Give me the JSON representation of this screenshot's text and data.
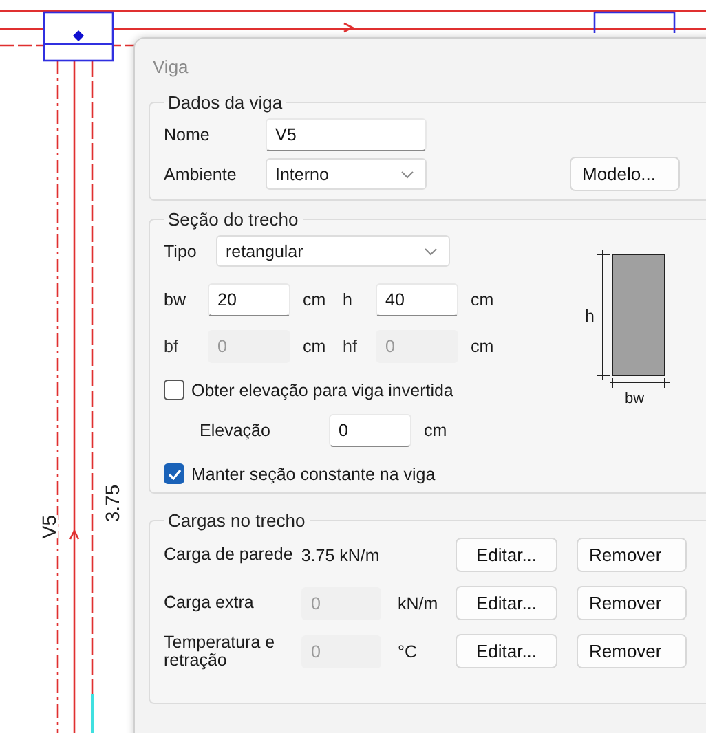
{
  "drawing": {
    "beam_label": "V5",
    "span_label": "3.75"
  },
  "dialog": {
    "title": "Viga"
  },
  "beam_data": {
    "title": "Dados da viga",
    "name_label": "Nome",
    "name_value": "V5",
    "environment_label": "Ambiente",
    "environment_value": "Interno",
    "model_button": "Modelo..."
  },
  "section": {
    "title": "Seção do trecho",
    "type_label": "Tipo",
    "type_value": "retangular",
    "fields": [
      {
        "label": "bw",
        "value": "20",
        "unit": "cm",
        "disabled": false
      },
      {
        "label": "h",
        "value": "40",
        "unit": "cm",
        "disabled": false
      },
      {
        "label": "bf",
        "value": "0",
        "unit": "cm",
        "disabled": true
      },
      {
        "label": "hf",
        "value": "0",
        "unit": "cm",
        "disabled": true
      }
    ],
    "invert": {
      "label": "Obter elevação para viga invertida",
      "checked": false
    },
    "elevation": {
      "label": "Elevação",
      "value": "0",
      "unit": "cm"
    },
    "constant": {
      "label": "Manter seção constante na viga",
      "checked": true
    },
    "diagram": {
      "height_label": "h",
      "width_label": "bw"
    }
  },
  "loads": {
    "title": "Cargas no trecho",
    "rows": [
      {
        "kind": "reading",
        "label": "Carga de parede",
        "value": "3.75 kN/m",
        "edit": "Editar...",
        "remove": "Remover"
      },
      {
        "kind": "field",
        "label": "Carga extra",
        "value": "0",
        "unit": "kN/m",
        "disabled": true,
        "edit": "Editar...",
        "remove": "Remover"
      },
      {
        "kind": "field",
        "label": "Temperatura e retração",
        "value": "0",
        "unit": "°C",
        "disabled": true,
        "edit": "Editar...",
        "remove": "Remover"
      }
    ]
  }
}
